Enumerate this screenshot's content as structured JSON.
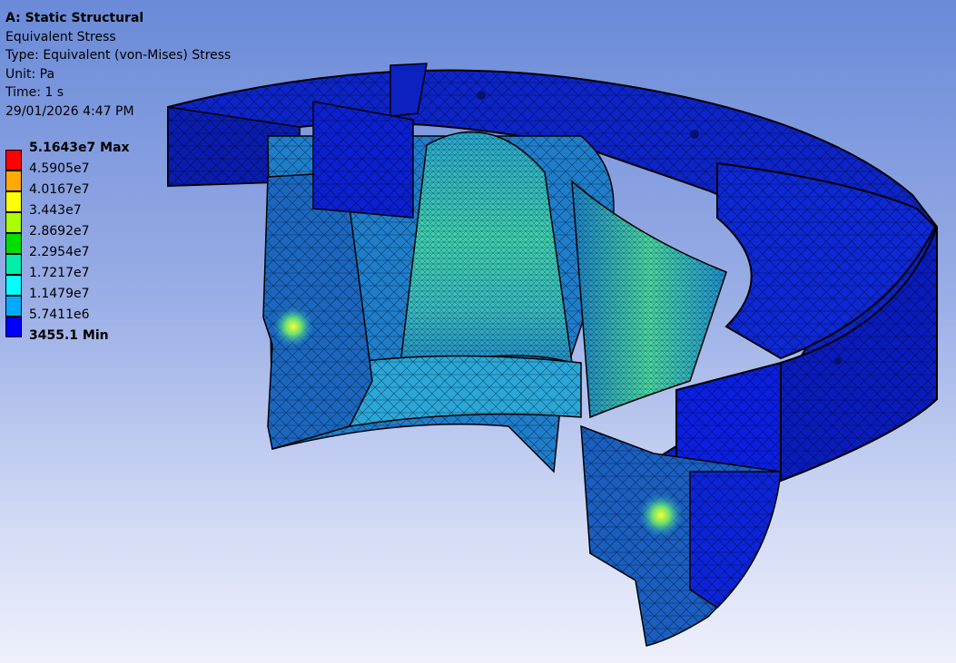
{
  "result": {
    "analysis_title": "A: Static Structural",
    "result_name": "Equivalent Stress",
    "result_type": "Type: Equivalent (von-Mises) Stress",
    "unit": "Unit: Pa",
    "time": "Time: 1 s",
    "timestamp": "29/01/2026 4:47 PM"
  },
  "legend": {
    "max_label": "5.1643e7 Max",
    "min_label": "3455.1 Min",
    "levels": [
      "4.5905e7",
      "4.0167e7",
      "3.443e7",
      "2.8692e7",
      "2.2954e7",
      "1.7217e7",
      "1.1479e7",
      "5.7411e6"
    ],
    "band_colors": [
      "#ff0000",
      "#ffaa00",
      "#ffff00",
      "#aaff00",
      "#00dd00",
      "#00eeaa",
      "#00ffff",
      "#00aaff",
      "#0000ff"
    ]
  },
  "colors": {
    "mesh_dark": "#08105a",
    "low_stress": "#0a1fe0",
    "mid_low_stress": "#1a8fd8",
    "mid_stress": "#39c9c0",
    "hot_spot": "#e7f020"
  }
}
